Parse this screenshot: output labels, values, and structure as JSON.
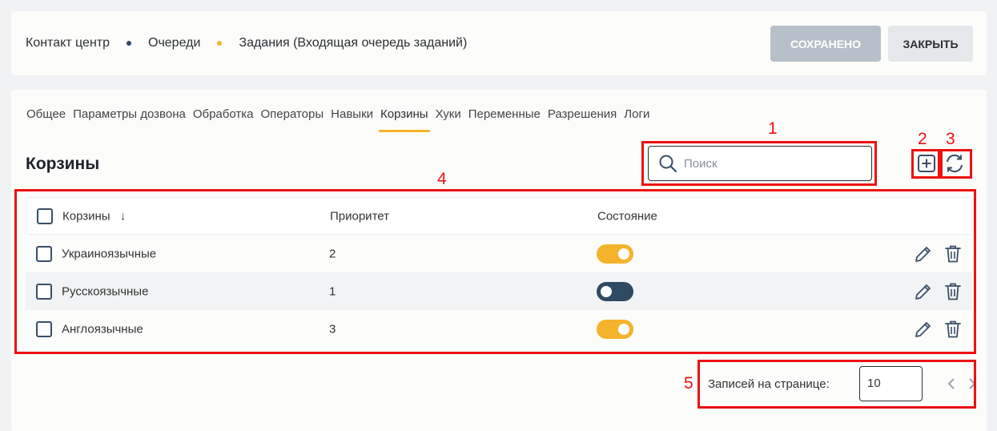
{
  "breadcrumb": [
    {
      "label": "Контакт центр"
    },
    {
      "label": "Очереди",
      "dot_color": "#2f4a63"
    },
    {
      "label": "Задания (Входящая очередь заданий)",
      "dot_color": "#f4b32a"
    }
  ],
  "header": {
    "saved_label": "СОХРАНЕНО",
    "close_label": "ЗАКРЫТЬ"
  },
  "tabs": [
    {
      "label": "Общее"
    },
    {
      "label": "Параметры дозвона"
    },
    {
      "label": "Обработка"
    },
    {
      "label": "Операторы"
    },
    {
      "label": "Навыки"
    },
    {
      "label": "Корзины",
      "active": true
    },
    {
      "label": "Хуки"
    },
    {
      "label": "Переменные"
    },
    {
      "label": "Разрешения"
    },
    {
      "label": "Логи"
    }
  ],
  "section": {
    "title": "Корзины"
  },
  "search": {
    "placeholder": "Поиск",
    "value": ""
  },
  "table": {
    "columns": [
      "Корзины",
      "Приоритет",
      "Состояние"
    ],
    "sort_indicator": "↓",
    "rows": [
      {
        "name": "Украиноязычные",
        "priority": "2",
        "enabled": true
      },
      {
        "name": "Русскоязычные",
        "priority": "1",
        "enabled": false
      },
      {
        "name": "Англоязычные",
        "priority": "3",
        "enabled": true
      }
    ]
  },
  "pagination": {
    "label": "Записей на странице:",
    "page_size": "10"
  },
  "annotations": [
    "1",
    "2",
    "3",
    "4",
    "5"
  ],
  "colors": {
    "accent": "#f4b32a",
    "dark": "#2f4a63",
    "annotation": "#ee1111"
  },
  "icons": [
    "search-icon",
    "add-icon",
    "refresh-icon",
    "edit-icon",
    "delete-icon",
    "chevron-left-icon",
    "chevron-right-icon"
  ]
}
